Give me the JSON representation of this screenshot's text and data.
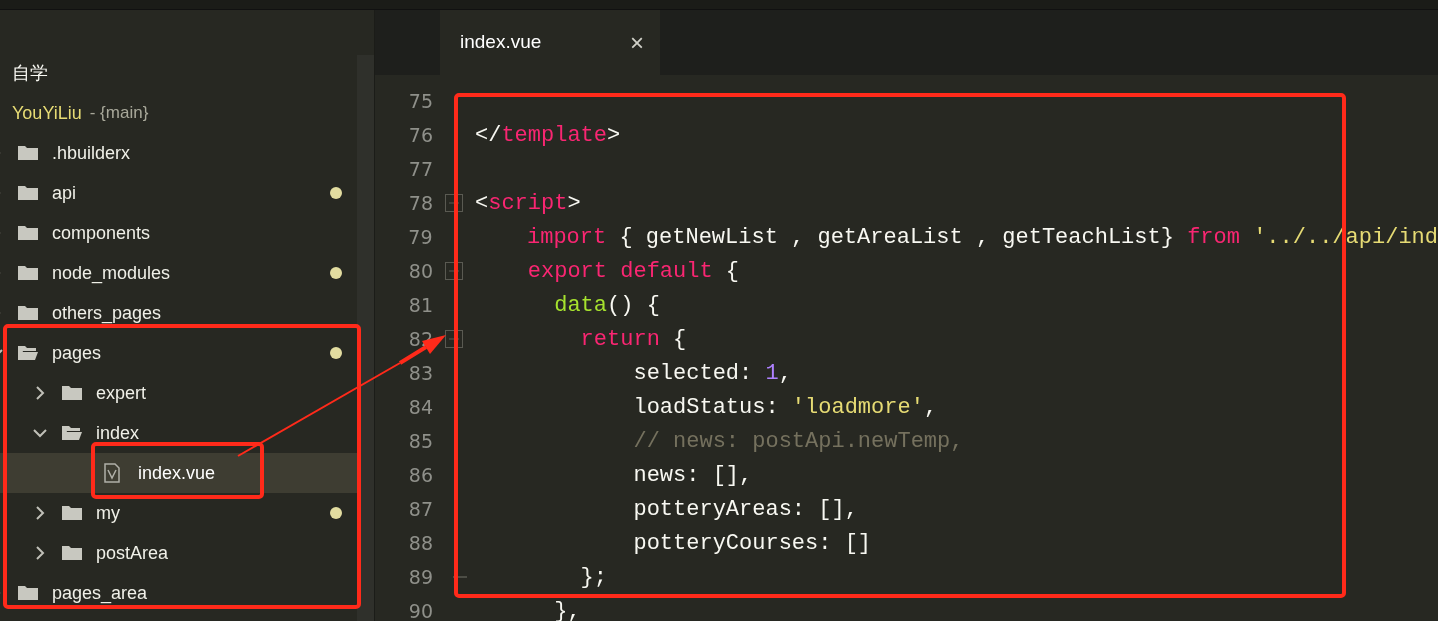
{
  "sidebar": {
    "workspace": "自学",
    "project": {
      "name": "YouYiLiu",
      "branch": "- {main}"
    },
    "tree": [
      {
        "name": ".hbuilderx",
        "kind": "folder",
        "expanded": false,
        "modified": false,
        "selected": false
      },
      {
        "name": "api",
        "kind": "folder",
        "expanded": false,
        "modified": true,
        "selected": false
      },
      {
        "name": "components",
        "kind": "folder",
        "expanded": false,
        "modified": false,
        "selected": false
      },
      {
        "name": "node_modules",
        "kind": "folder",
        "expanded": false,
        "modified": true,
        "selected": false
      },
      {
        "name": "others_pages",
        "kind": "folder",
        "expanded": false,
        "modified": false,
        "selected": false
      },
      {
        "name": "pages",
        "kind": "folder",
        "expanded": true,
        "modified": true,
        "selected": false,
        "children": [
          {
            "name": "expert",
            "kind": "folder",
            "expanded": false,
            "modified": false,
            "selected": false
          },
          {
            "name": "index",
            "kind": "folder",
            "expanded": true,
            "modified": false,
            "selected": false,
            "children": [
              {
                "name": "index.vue",
                "kind": "file",
                "modified": false,
                "selected": true
              }
            ]
          },
          {
            "name": "my",
            "kind": "folder",
            "expanded": false,
            "modified": true,
            "selected": false
          },
          {
            "name": "postArea",
            "kind": "folder",
            "expanded": false,
            "modified": false,
            "selected": false
          }
        ]
      },
      {
        "name": "pages_area",
        "kind": "folder",
        "expanded": false,
        "modified": false,
        "selected": false
      }
    ]
  },
  "tabs": [
    {
      "label": "index.vue",
      "selected": true,
      "close": "×"
    }
  ],
  "editor": {
    "lines": [
      {
        "number": "75",
        "foldable": false,
        "fold_end": false
      },
      {
        "number": "76",
        "foldable": false,
        "fold_end": false,
        "tokens": [
          {
            "text": "</",
            "color": "#f8f8f2"
          },
          {
            "text": "template",
            "color": "#f92672"
          },
          {
            "text": ">",
            "color": "#f8f8f2"
          }
        ]
      },
      {
        "number": "77",
        "foldable": false,
        "fold_end": false
      },
      {
        "number": "78",
        "foldable": true,
        "fold_end": false,
        "tokens": [
          {
            "text": "<",
            "color": "#f8f8f2"
          },
          {
            "text": "script",
            "color": "#f92672"
          },
          {
            "text": ">",
            "color": "#f8f8f2"
          }
        ]
      },
      {
        "number": "79",
        "foldable": false,
        "fold_end": false,
        "tokens": [
          {
            "text": "    import",
            "color": "#f92672"
          },
          {
            "text": " { getNewList , getAreaList , getTeachList} ",
            "color": "#f8f8f2"
          },
          {
            "text": "from",
            "color": "#f92672"
          },
          {
            "text": " '../../api/ind",
            "color": "#e6db74"
          }
        ]
      },
      {
        "number": "80",
        "foldable": true,
        "fold_end": false,
        "tokens": [
          {
            "text": "    export default",
            "color": "#f92672"
          },
          {
            "text": " {",
            "color": "#f8f8f2"
          }
        ]
      },
      {
        "number": "81",
        "foldable": false,
        "fold_end": false,
        "tokens": [
          {
            "text": "      data",
            "color": "#a6e22e"
          },
          {
            "text": "() {",
            "color": "#f8f8f2"
          }
        ]
      },
      {
        "number": "82",
        "foldable": true,
        "fold_end": false,
        "tokens": [
          {
            "text": "        return",
            "color": "#f92672"
          },
          {
            "text": " {",
            "color": "#f8f8f2"
          }
        ]
      },
      {
        "number": "83",
        "foldable": false,
        "fold_end": false,
        "tokens": [
          {
            "text": "            selected: ",
            "color": "#f8f8f2"
          },
          {
            "text": "1",
            "color": "#ae81ff"
          },
          {
            "text": ",",
            "color": "#f8f8f2"
          }
        ]
      },
      {
        "number": "84",
        "foldable": false,
        "fold_end": false,
        "tokens": [
          {
            "text": "            loadStatus: ",
            "color": "#f8f8f2"
          },
          {
            "text": "'loadmore'",
            "color": "#e6db74"
          },
          {
            "text": ",",
            "color": "#f8f8f2"
          }
        ]
      },
      {
        "number": "85",
        "foldable": false,
        "fold_end": false,
        "tokens": [
          {
            "text": "            // news: postApi.newTemp,",
            "color": "#75715e"
          }
        ]
      },
      {
        "number": "86",
        "foldable": false,
        "fold_end": false,
        "tokens": [
          {
            "text": "            news: [],",
            "color": "#f8f8f2"
          }
        ]
      },
      {
        "number": "87",
        "foldable": false,
        "fold_end": false,
        "tokens": [
          {
            "text": "            potteryAreas: [],",
            "color": "#f8f8f2"
          }
        ]
      },
      {
        "number": "88",
        "foldable": false,
        "fold_end": false,
        "tokens": [
          {
            "text": "            potteryCourses: []",
            "color": "#f8f8f2"
          }
        ]
      },
      {
        "number": "89",
        "foldable": false,
        "fold_end": true,
        "tokens": [
          {
            "text": "        };",
            "color": "#f8f8f2"
          }
        ]
      },
      {
        "number": "90",
        "foldable": false,
        "fold_end": false,
        "tokens": [
          {
            "text": "      },",
            "color": "#f8f8f2"
          }
        ]
      }
    ]
  }
}
